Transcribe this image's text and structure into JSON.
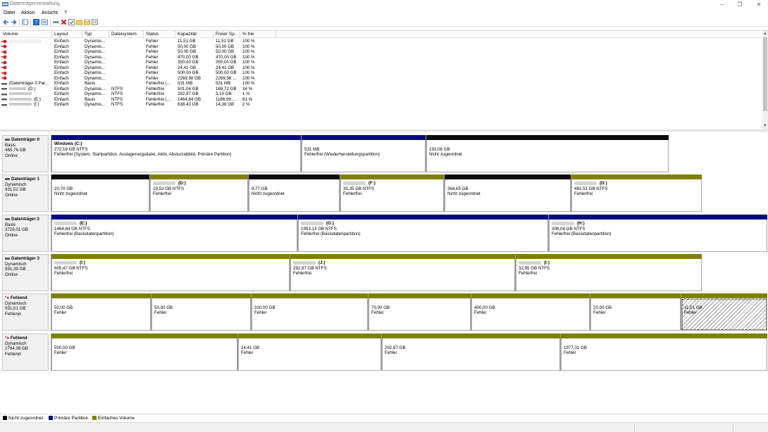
{
  "window": {
    "title": "Datenträgerverwaltung"
  },
  "menu": [
    "Datei",
    "Aktion",
    "Ansicht",
    "?"
  ],
  "colors": {
    "unallocated": "#0a0a0a",
    "primary": "#0a0a80",
    "simple": "#808000",
    "missing": "#cc2222"
  },
  "list": {
    "headers": [
      "Volume",
      "Layout",
      "Typ",
      "Dateisystem",
      "Status",
      "Kapazität",
      "Freier Sp...",
      "% frei"
    ],
    "rows": [
      [
        "",
        "Einfach",
        "Dynamis...",
        "",
        "Fehler",
        "11,51 GB",
        "11,51 GB",
        "100 %"
      ],
      [
        "",
        "Einfach",
        "Dynamis...",
        "",
        "Fehler",
        "50,00 GB",
        "50,00 GB",
        "100 %"
      ],
      [
        "",
        "Einfach",
        "Dynamis...",
        "",
        "Fehler",
        "50,00 GB",
        "50,00 GB",
        "100 %"
      ],
      [
        "",
        "Einfach",
        "Dynamis...",
        "",
        "Fehler",
        "470,00 GB",
        "470,00 GB",
        "100 %"
      ],
      [
        "",
        "Einfach",
        "Dynamis...",
        "",
        "Fehler",
        "350,00 GB",
        "350,00 GB",
        "100 %"
      ],
      [
        "",
        "Einfach",
        "Dynamis...",
        "",
        "Fehler",
        "24,41 GB",
        "24,41 GB",
        "100 %"
      ],
      [
        "",
        "Einfach",
        "Dynamis...",
        "",
        "Fehler",
        "500,00 GB",
        "500,00 GB",
        "100 %"
      ],
      [
        "",
        "Einfach",
        "Dynamis...",
        "",
        "Fehler",
        "2269,98 GB",
        "2269,98 ...",
        "100 %"
      ],
      [
        "(Datenträger 0 Par...",
        "Einfach",
        "Basis",
        "",
        "Fehlerfrei (...",
        "531 MB",
        "531 MB",
        "100 %"
      ],
      [
        "(D:)",
        "Einfach",
        "Dynamis...",
        "NTFS",
        "Fehlerfrei",
        "501,04 GB",
        "169,72 GB",
        "34 %"
      ],
      [
        "",
        "Einfach",
        "Dynamis...",
        "NTFS",
        "Fehlerfrei",
        "292,97 GB",
        "3,10 GB",
        "1 %"
      ],
      [
        "(E:)",
        "Einfach",
        "Basis",
        "NTFS",
        "Fehlerfrei (...",
        "1464,84 GB",
        "1186,99 ...",
        "81 %"
      ],
      [
        "(I:)",
        "Einfach",
        "Dynamis...",
        "NTFS",
        "Fehlerfrei",
        "638,42 GB",
        "14,38 GB",
        "2 %"
      ]
    ]
  },
  "disks": [
    {
      "name": "Datenträger 0",
      "type": "Basis",
      "size": "465,76 GB",
      "state": "Online",
      "partitions": [
        {
          "title": "Windows  (C:)",
          "size": "272,18 GB NTFS",
          "status": "Fehlerfrei (System, Startpartition, Auslagerungsdatei, Aktiv, Absturzabbild, Primäre Partition)"
        },
        {
          "title": "",
          "size": "531 MB",
          "status": "Fehlerfrei (Wiederherstellungspartition)"
        },
        {
          "title": "",
          "size": "193,06 GB",
          "status": "Nicht zugeordnet"
        }
      ]
    },
    {
      "name": "Datenträger 1",
      "type": "Dynamisch",
      "size": "931,52 GB",
      "state": "Online",
      "partitions": [
        {
          "title": "",
          "size": "20,70 GB",
          "status": "Nicht zugeordnet"
        },
        {
          "title": "(D:)",
          "size": "19,53 GB NTFS",
          "status": "Fehlerfrei"
        },
        {
          "title": "",
          "size": "9,77 GB",
          "status": "Nicht zugeordnet"
        },
        {
          "title": "(F:)",
          "size": "35,35 GB NTFS",
          "status": "Fehlerfrei"
        },
        {
          "title": "",
          "size": "364,65 GB",
          "status": "Nicht zugeordnet"
        },
        {
          "title": "(D:)",
          "size": "481,51 GB NTFS",
          "status": "Fehlerfrei"
        }
      ]
    },
    {
      "name": "Datenträger 2",
      "type": "Basis",
      "size": "3726,01 GB",
      "state": "Online",
      "partitions": [
        {
          "title": "(E:)",
          "size": "1464,84 GB NTFS",
          "status": "Fehlerfrei (Basisdatenpartition)"
        },
        {
          "title": "(G:)",
          "size": "1953,13 GB NTFS",
          "status": "Fehlerfrei (Basisdatenpartition)"
        },
        {
          "title": "(H:)",
          "size": "308,04 GB NTFS",
          "status": "Fehlerfrei (Basisdatenpartition)"
        }
      ]
    },
    {
      "name": "Datenträger 3",
      "type": "Dynamisch",
      "size": "931,39 GB",
      "state": "Online",
      "partitions": [
        {
          "title": "(I:)",
          "size": "605,47 GB NTFS",
          "status": "Fehlerfrei"
        },
        {
          "title": "(J:)",
          "size": "292,97 GB NTFS",
          "status": "Fehlerfrei"
        },
        {
          "title": "(I:)",
          "size": "32,95 GB NTFS",
          "status": "Fehlerfrei"
        }
      ]
    },
    {
      "name": "Fehlend",
      "type": "Dynamisch",
      "size": "931,51 GB",
      "state": "Fehlend",
      "partitions": [
        {
          "title": "",
          "size": "50,00 GB",
          "status": "Fehler"
        },
        {
          "title": "",
          "size": "50,00 GB",
          "status": "Fehler"
        },
        {
          "title": "",
          "size": "330,00 GB",
          "status": "Fehler"
        },
        {
          "title": "",
          "size": "70,00 GB",
          "status": "Fehler"
        },
        {
          "title": "",
          "size": "400,00 GB",
          "status": "Fehler"
        },
        {
          "title": "",
          "size": "20,00 GB",
          "status": "Fehler"
        },
        {
          "title": "",
          "size": "11,51 GB",
          "status": "Fehler"
        }
      ]
    },
    {
      "name": "Fehlend",
      "type": "Dynamisch",
      "size": "2794,39 GB",
      "state": "Fehlend",
      "partitions": [
        {
          "title": "",
          "size": "500,00 GB",
          "status": "Fehler"
        },
        {
          "title": "",
          "size": "24,41 GB",
          "status": "Fehler"
        },
        {
          "title": "",
          "size": "292,97 GB",
          "status": "Fehler"
        },
        {
          "title": "",
          "size": "1977,01 GB",
          "status": "Fehler"
        }
      ]
    }
  ],
  "legend": [
    "Nicht zugeordnet",
    "Primäre Partition",
    "Einfaches Volume"
  ]
}
